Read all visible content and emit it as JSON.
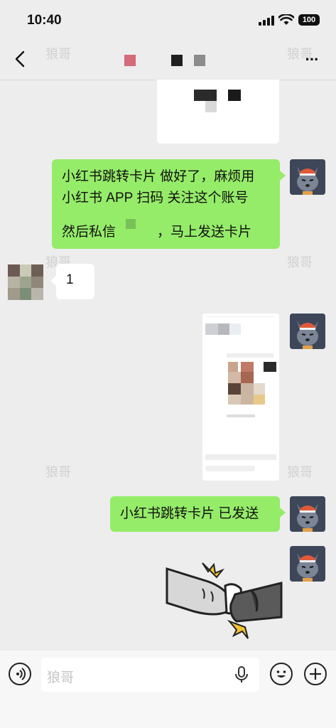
{
  "status_bar": {
    "time": "10:40",
    "battery": "100"
  },
  "watermark": "狼哥",
  "messages": {
    "sent_1": {
      "line1": "小红书跳转卡片 做好了，麻烦用",
      "line2": "小红书 APP 扫码 关注这个账号",
      "line3a": "然后私信",
      "line3b": "，马上发送卡片"
    },
    "received_1": "1",
    "sent_2": "小红书跳转卡片 已发送"
  },
  "input": {
    "placeholder": "狼哥"
  },
  "icons": [
    "back-icon",
    "more-icon",
    "voice-icon",
    "microphone-icon",
    "emoji-icon",
    "plus-icon"
  ],
  "colors": {
    "sent_bubble": "#95ec69",
    "background": "#ededed"
  }
}
